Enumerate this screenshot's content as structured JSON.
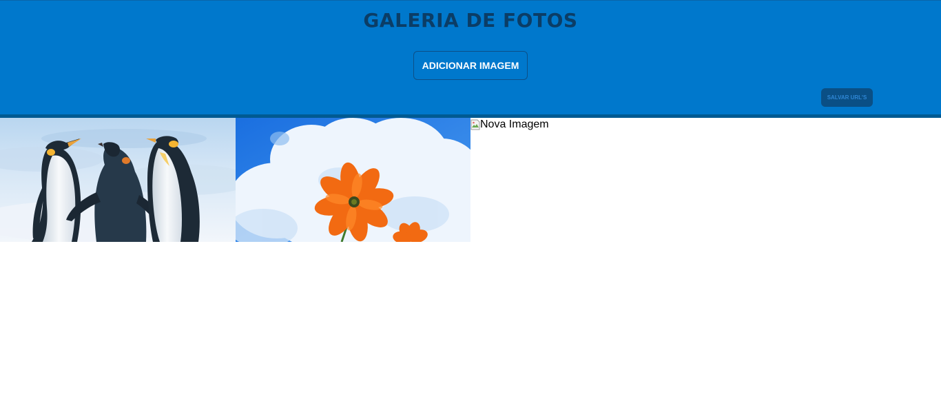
{
  "header": {
    "title": "GALERIA DE FOTOS",
    "add_button_label": "ADICIONAR IMAGEM",
    "save_button_label": "SALVAR URL'S"
  },
  "gallery": {
    "images": [
      {
        "subject": "penguins"
      },
      {
        "subject": "orange-flower-sky"
      },
      {
        "alt_text": "Nova Imagem",
        "loaded": false
      }
    ]
  },
  "colors": {
    "header_bg": "#0078cc",
    "header_border": "#005a92",
    "title_color": "#0b3d66",
    "save_button_bg": "#0a4f85"
  }
}
